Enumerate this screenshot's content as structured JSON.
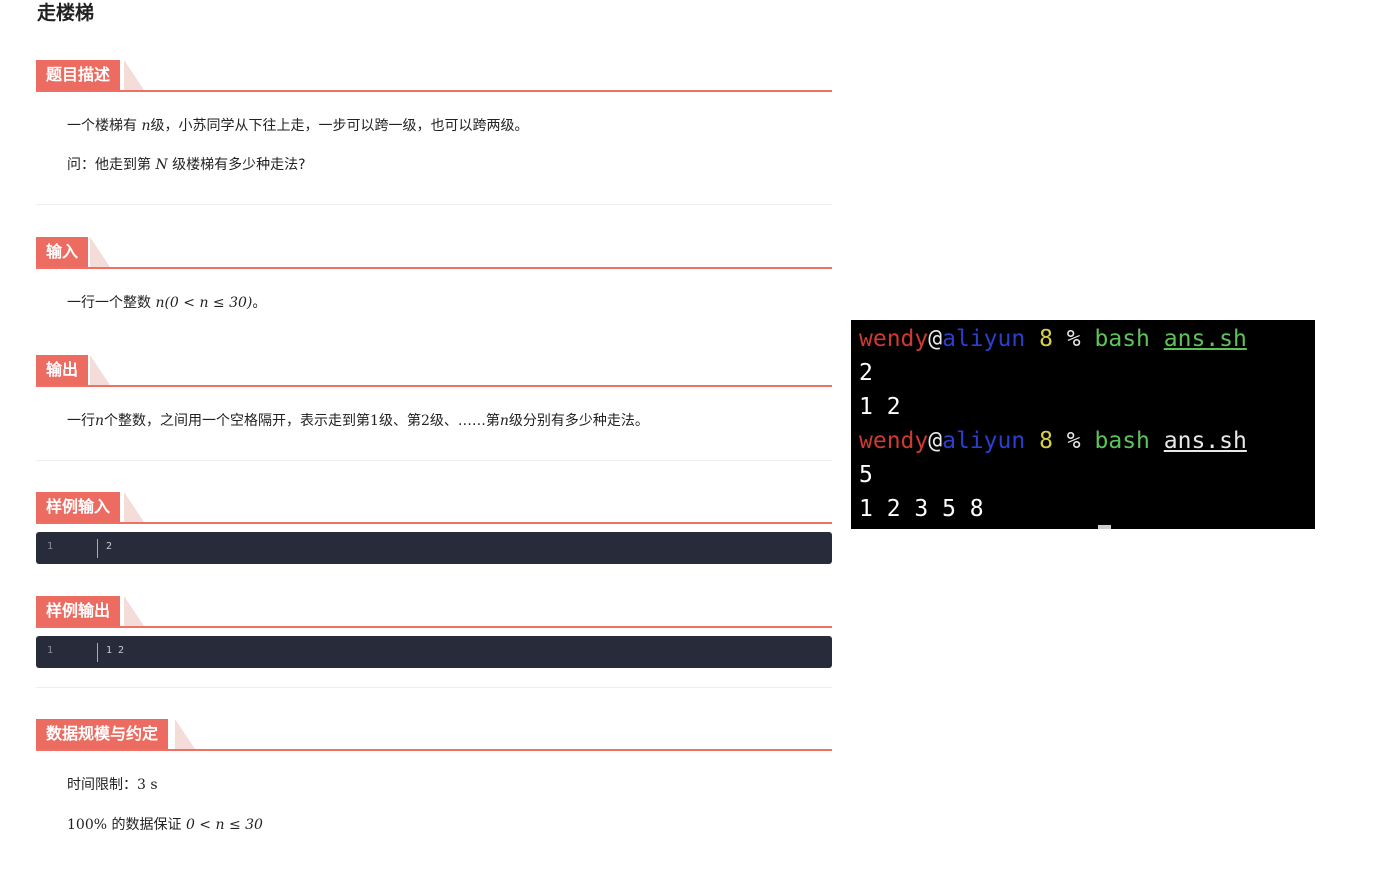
{
  "problem": {
    "title": "走楼梯",
    "sections": {
      "desc": {
        "heading": "题目描述",
        "line1": {
          "pre": "一个楼梯有 ",
          "var": "n",
          "post": "级，小苏同学从下往上走，一步可以跨一级，也可以跨两级。"
        },
        "line2": {
          "pre": "问：他走到第 ",
          "var": "N",
          "post": " 级楼梯有多少种走法?"
        }
      },
      "input": {
        "heading": "输入",
        "line": {
          "pre": "一行一个整数 ",
          "math": "n(0 < n ≤ 30)",
          "post": "。"
        }
      },
      "output": {
        "heading": "输出",
        "line": {
          "pre": "一行",
          "var1": "n",
          "mid1": "个整数，之间用一个空格隔开，表示走到第",
          "num1": "1",
          "mid2": "级、第",
          "num2": "2",
          "mid3": "级、……第",
          "var2": "n",
          "post": "级分别有多少种走法。"
        }
      },
      "sample_input": {
        "heading": "样例输入",
        "line_no": "1",
        "code": "2"
      },
      "sample_output": {
        "heading": "样例输出",
        "line_no": "1",
        "code": "1 2"
      },
      "limits": {
        "heading": "数据规模与约定",
        "time": {
          "label": "时间限制：",
          "value": "3 s"
        },
        "data": {
          "pct": "100%",
          "label": " 的数据保证 ",
          "math": "0 < n ≤ 30"
        }
      }
    }
  },
  "terminal": {
    "colors": {
      "background": "#000000",
      "user": "#cc3a32",
      "host": "#2b3fcf",
      "dir": "#d9cf4c",
      "command": "#5ec25a"
    },
    "runs": [
      {
        "user": "wendy",
        "at": "@",
        "host": "aliyun",
        "dir": "8",
        "symbol": "%",
        "command": "bash",
        "arg": "ans.sh",
        "output": [
          "2",
          "1 2"
        ]
      },
      {
        "user": "wendy",
        "at": "@",
        "host": "aliyun",
        "dir": "8",
        "symbol": "%",
        "command": "bash",
        "arg": "ans.sh",
        "output": [
          "5",
          "1 2 3 5 8"
        ]
      }
    ]
  }
}
